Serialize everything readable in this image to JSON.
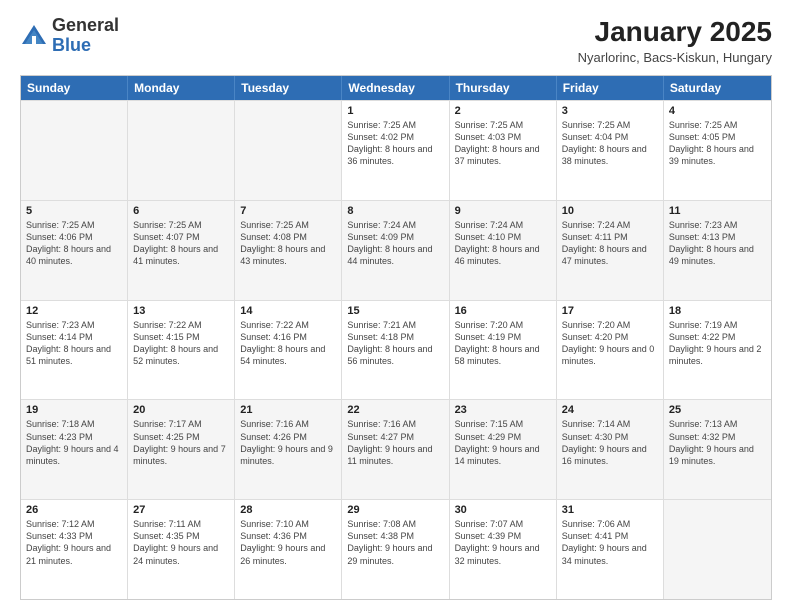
{
  "logo": {
    "general": "General",
    "blue": "Blue"
  },
  "title": "January 2025",
  "subtitle": "Nyarlorinc, Bacs-Kiskun, Hungary",
  "header_days": [
    "Sunday",
    "Monday",
    "Tuesday",
    "Wednesday",
    "Thursday",
    "Friday",
    "Saturday"
  ],
  "weeks": [
    [
      {
        "day": "",
        "info": ""
      },
      {
        "day": "",
        "info": ""
      },
      {
        "day": "",
        "info": ""
      },
      {
        "day": "1",
        "info": "Sunrise: 7:25 AM\nSunset: 4:02 PM\nDaylight: 8 hours and 36 minutes."
      },
      {
        "day": "2",
        "info": "Sunrise: 7:25 AM\nSunset: 4:03 PM\nDaylight: 8 hours and 37 minutes."
      },
      {
        "day": "3",
        "info": "Sunrise: 7:25 AM\nSunset: 4:04 PM\nDaylight: 8 hours and 38 minutes."
      },
      {
        "day": "4",
        "info": "Sunrise: 7:25 AM\nSunset: 4:05 PM\nDaylight: 8 hours and 39 minutes."
      }
    ],
    [
      {
        "day": "5",
        "info": "Sunrise: 7:25 AM\nSunset: 4:06 PM\nDaylight: 8 hours and 40 minutes."
      },
      {
        "day": "6",
        "info": "Sunrise: 7:25 AM\nSunset: 4:07 PM\nDaylight: 8 hours and 41 minutes."
      },
      {
        "day": "7",
        "info": "Sunrise: 7:25 AM\nSunset: 4:08 PM\nDaylight: 8 hours and 43 minutes."
      },
      {
        "day": "8",
        "info": "Sunrise: 7:24 AM\nSunset: 4:09 PM\nDaylight: 8 hours and 44 minutes."
      },
      {
        "day": "9",
        "info": "Sunrise: 7:24 AM\nSunset: 4:10 PM\nDaylight: 8 hours and 46 minutes."
      },
      {
        "day": "10",
        "info": "Sunrise: 7:24 AM\nSunset: 4:11 PM\nDaylight: 8 hours and 47 minutes."
      },
      {
        "day": "11",
        "info": "Sunrise: 7:23 AM\nSunset: 4:13 PM\nDaylight: 8 hours and 49 minutes."
      }
    ],
    [
      {
        "day": "12",
        "info": "Sunrise: 7:23 AM\nSunset: 4:14 PM\nDaylight: 8 hours and 51 minutes."
      },
      {
        "day": "13",
        "info": "Sunrise: 7:22 AM\nSunset: 4:15 PM\nDaylight: 8 hours and 52 minutes."
      },
      {
        "day": "14",
        "info": "Sunrise: 7:22 AM\nSunset: 4:16 PM\nDaylight: 8 hours and 54 minutes."
      },
      {
        "day": "15",
        "info": "Sunrise: 7:21 AM\nSunset: 4:18 PM\nDaylight: 8 hours and 56 minutes."
      },
      {
        "day": "16",
        "info": "Sunrise: 7:20 AM\nSunset: 4:19 PM\nDaylight: 8 hours and 58 minutes."
      },
      {
        "day": "17",
        "info": "Sunrise: 7:20 AM\nSunset: 4:20 PM\nDaylight: 9 hours and 0 minutes."
      },
      {
        "day": "18",
        "info": "Sunrise: 7:19 AM\nSunset: 4:22 PM\nDaylight: 9 hours and 2 minutes."
      }
    ],
    [
      {
        "day": "19",
        "info": "Sunrise: 7:18 AM\nSunset: 4:23 PM\nDaylight: 9 hours and 4 minutes."
      },
      {
        "day": "20",
        "info": "Sunrise: 7:17 AM\nSunset: 4:25 PM\nDaylight: 9 hours and 7 minutes."
      },
      {
        "day": "21",
        "info": "Sunrise: 7:16 AM\nSunset: 4:26 PM\nDaylight: 9 hours and 9 minutes."
      },
      {
        "day": "22",
        "info": "Sunrise: 7:16 AM\nSunset: 4:27 PM\nDaylight: 9 hours and 11 minutes."
      },
      {
        "day": "23",
        "info": "Sunrise: 7:15 AM\nSunset: 4:29 PM\nDaylight: 9 hours and 14 minutes."
      },
      {
        "day": "24",
        "info": "Sunrise: 7:14 AM\nSunset: 4:30 PM\nDaylight: 9 hours and 16 minutes."
      },
      {
        "day": "25",
        "info": "Sunrise: 7:13 AM\nSunset: 4:32 PM\nDaylight: 9 hours and 19 minutes."
      }
    ],
    [
      {
        "day": "26",
        "info": "Sunrise: 7:12 AM\nSunset: 4:33 PM\nDaylight: 9 hours and 21 minutes."
      },
      {
        "day": "27",
        "info": "Sunrise: 7:11 AM\nSunset: 4:35 PM\nDaylight: 9 hours and 24 minutes."
      },
      {
        "day": "28",
        "info": "Sunrise: 7:10 AM\nSunset: 4:36 PM\nDaylight: 9 hours and 26 minutes."
      },
      {
        "day": "29",
        "info": "Sunrise: 7:08 AM\nSunset: 4:38 PM\nDaylight: 9 hours and 29 minutes."
      },
      {
        "day": "30",
        "info": "Sunrise: 7:07 AM\nSunset: 4:39 PM\nDaylight: 9 hours and 32 minutes."
      },
      {
        "day": "31",
        "info": "Sunrise: 7:06 AM\nSunset: 4:41 PM\nDaylight: 9 hours and 34 minutes."
      },
      {
        "day": "",
        "info": ""
      }
    ]
  ]
}
